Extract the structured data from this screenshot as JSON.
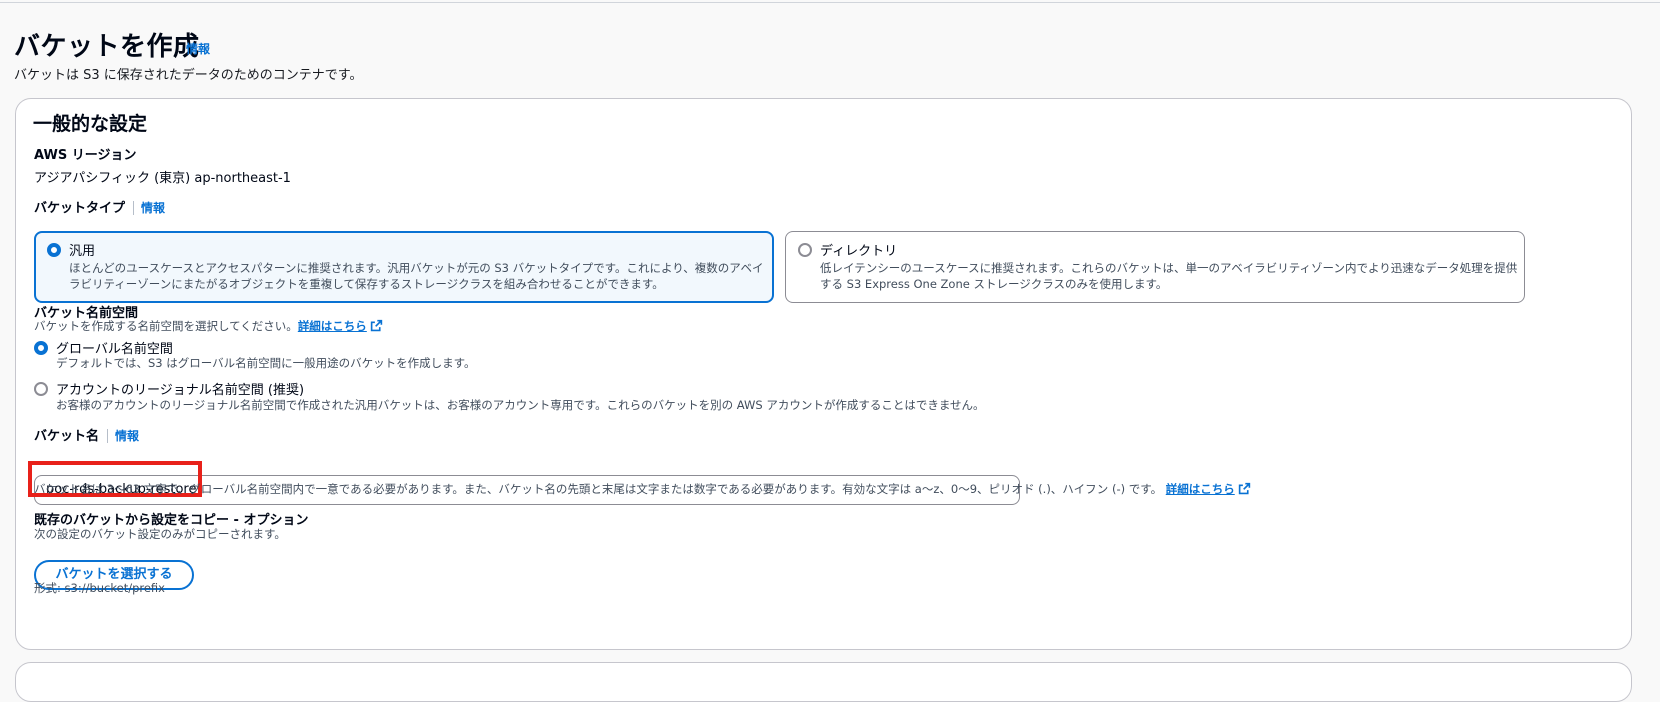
{
  "page": {
    "title": "バケットを作成",
    "info": "情報",
    "subtitle": "バケットは S3 に保存されたデータのためのコンテナです。"
  },
  "general": {
    "heading": "一般的な設定",
    "region_label": "AWS リージョン",
    "region_value": "アジアパシフィック (東京) ap-northeast-1"
  },
  "bucket_type": {
    "label": "バケットタイプ",
    "info": "情報",
    "options": [
      {
        "title": "汎用",
        "desc_line1": "ほとんどのユースケースとアクセスパターンに推奨されます。汎用バケットが元の S3 バケットタイプです。これにより、複数のアベイ",
        "desc_line2": "ラビリティーゾーンにまたがるオブジェクトを重複して保存するストレージクラスを組み合わせることができます。",
        "selected": true
      },
      {
        "title": "ディレクトリ",
        "desc_line1": "低レイテンシーのユースケースに推奨されます。これらのバケットは、単一のアベイラビリティゾーン内でより迅速なデータ処理を提供",
        "desc_line2": "する S3 Express One Zone ストレージクラスのみを使用します。",
        "selected": false
      }
    ]
  },
  "namespace": {
    "label": "バケット名前空間",
    "desc": "バケットを作成する名前空間を選択してください。",
    "learn_more": "詳細はこちら",
    "options": [
      {
        "title": "グローバル名前空間",
        "desc": "デフォルトでは、S3 はグローバル名前空間に一般用途のバケットを作成します。",
        "selected": true
      },
      {
        "title": "アカウントのリージョナル名前空間 (推奨)",
        "desc": "お客様のアカウントのリージョナル名前空間で作成された汎用バケットは、お客様のアカウント専用です。これらのバケットを別の AWS アカウントが作成することはできません。",
        "selected": false
      }
    ]
  },
  "bucket_name": {
    "label": "バケット名",
    "info": "情報",
    "value": "poc-rds-backup-restore",
    "hint": "バケット名は 3〜63 文字で、グローバル名前空間内で一意である必要があります。また、バケット名の先頭と末尾は文字または数字である必要があります。有効な文字は a〜z、0〜9、ピリオド (.)、ハイフン (-) です。",
    "learn_more": "詳細はこちら"
  },
  "copy_settings": {
    "label": "既存のバケットから設定をコピー - オプション",
    "desc": "次の設定のバケット設定のみがコピーされます。",
    "button": "バケットを選択する",
    "format": "形式: s3://bucket/prefix"
  },
  "colors": {
    "accent": "#0972d3",
    "highlight": "#e8211a",
    "selected_tile_bg": "#f2f8fd"
  }
}
